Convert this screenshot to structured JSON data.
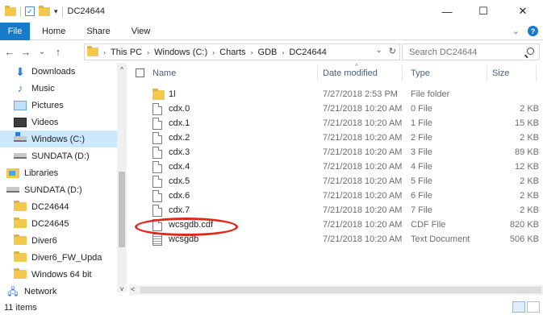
{
  "window": {
    "title": "DC24644",
    "controls": {
      "minimize": "—",
      "maximize": "☐",
      "close": "✕"
    }
  },
  "ribbon": {
    "file": "File",
    "tabs": [
      "Home",
      "Share",
      "View"
    ],
    "expand": "⌄",
    "help": "?"
  },
  "nav": {
    "back": "←",
    "forward": "→",
    "recent": "⌄",
    "up": "↑"
  },
  "address": {
    "crumbs": [
      "This PC",
      "Windows (C:)",
      "Charts",
      "GDB",
      "DC24644"
    ],
    "separator": "›",
    "dropdown": "⌄",
    "refresh": "↻"
  },
  "search": {
    "placeholder": "Search DC24644"
  },
  "sidebar": {
    "collapse_arrow": "^",
    "items": [
      {
        "label": "Downloads",
        "icon": "downloads-icon"
      },
      {
        "label": "Music",
        "icon": "music-icon"
      },
      {
        "label": "Pictures",
        "icon": "pictures-icon"
      },
      {
        "label": "Videos",
        "icon": "videos-icon"
      },
      {
        "label": "Windows (C:)",
        "icon": "windows-drive-icon"
      },
      {
        "label": "SUNDATA (D:)",
        "icon": "drive-icon"
      },
      {
        "label": "Libraries",
        "icon": "libraries-icon"
      },
      {
        "label": "SUNDATA (D:)",
        "icon": "drive-icon"
      },
      {
        "label": "DC24644",
        "icon": "folder-icon"
      },
      {
        "label": "DC24645",
        "icon": "folder-icon"
      },
      {
        "label": "Diver6",
        "icon": "folder-icon"
      },
      {
        "label": "Diver6_FW_Upda",
        "icon": "folder-icon"
      },
      {
        "label": "Windows 64 bit",
        "icon": "folder-icon"
      },
      {
        "label": "Network",
        "icon": "network-icon"
      }
    ]
  },
  "columns": {
    "name": "Name",
    "date": "Date modified",
    "type": "Type",
    "size": "Size"
  },
  "files": [
    {
      "name": "1l",
      "date": "7/27/2018 2:53 PM",
      "type": "File folder",
      "size": "",
      "kind": "folder"
    },
    {
      "name": "cdx.0",
      "date": "7/21/2018 10:20 AM",
      "type": "0 File",
      "size": "2 KB",
      "kind": "file"
    },
    {
      "name": "cdx.1",
      "date": "7/21/2018 10:20 AM",
      "type": "1 File",
      "size": "15 KB",
      "kind": "file"
    },
    {
      "name": "cdx.2",
      "date": "7/21/2018 10:20 AM",
      "type": "2 File",
      "size": "2 KB",
      "kind": "file"
    },
    {
      "name": "cdx.3",
      "date": "7/21/2018 10:20 AM",
      "type": "3 File",
      "size": "89 KB",
      "kind": "file"
    },
    {
      "name": "cdx.4",
      "date": "7/21/2018 10:20 AM",
      "type": "4 File",
      "size": "12 KB",
      "kind": "file"
    },
    {
      "name": "cdx.5",
      "date": "7/21/2018 10:20 AM",
      "type": "5 File",
      "size": "2 KB",
      "kind": "file"
    },
    {
      "name": "cdx.6",
      "date": "7/21/2018 10:20 AM",
      "type": "6 File",
      "size": "2 KB",
      "kind": "file"
    },
    {
      "name": "cdx.7",
      "date": "7/21/2018 10:20 AM",
      "type": "7 File",
      "size": "2 KB",
      "kind": "file"
    },
    {
      "name": "wcsgdb.cdf",
      "date": "7/21/2018 10:20 AM",
      "type": "CDF File",
      "size": "820 KB",
      "kind": "file"
    },
    {
      "name": "wcsgdb",
      "date": "7/21/2018 10:20 AM",
      "type": "Text Document",
      "size": "506 KB",
      "kind": "text"
    }
  ],
  "annotation": {
    "highlight_color": "#e3261c"
  },
  "status": {
    "count": "11 items"
  },
  "scroll": {
    "left": "<",
    "down": "v",
    "up": "^"
  },
  "colors": {
    "accent": "#1979ca",
    "selection": "#cce8ff"
  }
}
